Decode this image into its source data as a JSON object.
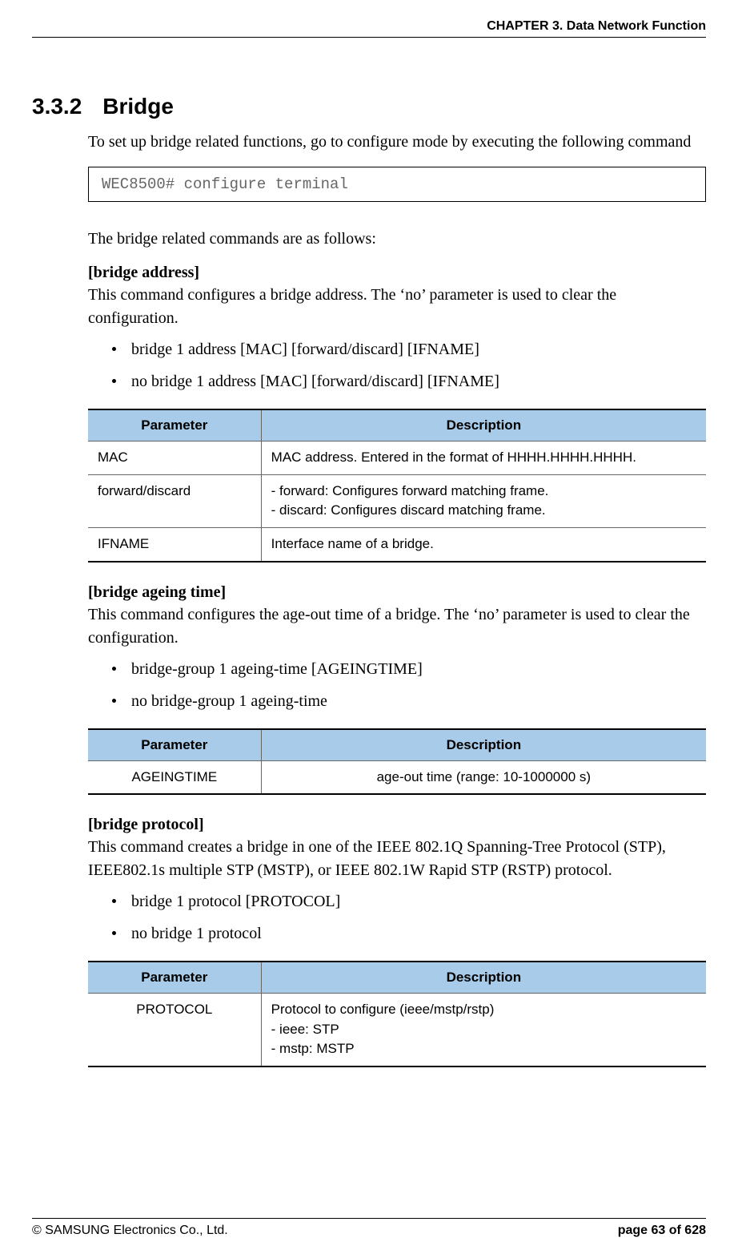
{
  "header": {
    "chapter": "CHAPTER 3. Data Network Function"
  },
  "section": {
    "number": "3.3.2",
    "title": "Bridge"
  },
  "intro": "To set up bridge related functions, go to configure mode by executing the following command",
  "command_box": "WEC8500# configure terminal",
  "after_cmd": "The bridge related commands are as follows:",
  "sub1": {
    "title": "[bridge address]",
    "desc": "This command configures a bridge address. The ‘no’ parameter is used to clear the configuration.",
    "items": [
      "bridge 1 address [MAC] [forward/discard] [IFNAME]",
      "no bridge 1 address [MAC] [forward/discard] [IFNAME]"
    ]
  },
  "table1": {
    "h_param": "Parameter",
    "h_desc": "Description",
    "rows": [
      {
        "p": "MAC",
        "d": "MAC address. Entered in the format of HHHH.HHHH.HHHH."
      },
      {
        "p": "forward/discard",
        "d": "- forward: Configures forward matching frame.\n- discard: Configures discard matching frame."
      },
      {
        "p": "IFNAME",
        "d": "Interface name of a bridge."
      }
    ]
  },
  "sub2": {
    "title": "[bridge ageing time]",
    "desc": "This command configures the age-out time of a bridge. The ‘no’ parameter is used to clear the configuration.",
    "items": [
      "bridge-group 1 ageing-time [AGEINGTIME]",
      "no bridge-group 1 ageing-time"
    ]
  },
  "table2": {
    "h_param": "Parameter",
    "h_desc": "Description",
    "rows": [
      {
        "p": "AGEINGTIME",
        "d": "age-out time (range: 10-1000000 s)"
      }
    ]
  },
  "sub3": {
    "title": "[bridge protocol]",
    "desc": "This command creates a bridge in one of the IEEE 802.1Q Spanning-Tree Protocol (STP), IEEE802.1s multiple STP (MSTP), or IEEE 802.1W Rapid STP (RSTP) protocol.",
    "items": [
      "bridge 1 protocol [PROTOCOL]",
      "no bridge 1 protocol"
    ]
  },
  "table3": {
    "h_param": "Parameter",
    "h_desc": "Description",
    "rows": [
      {
        "p": "PROTOCOL",
        "d": "Protocol to configure (ieee/mstp/rstp)\n- ieee: STP\n- mstp: MSTP"
      }
    ]
  },
  "footer": {
    "left": "© SAMSUNG Electronics Co., Ltd.",
    "right": "page 63 of 628"
  }
}
